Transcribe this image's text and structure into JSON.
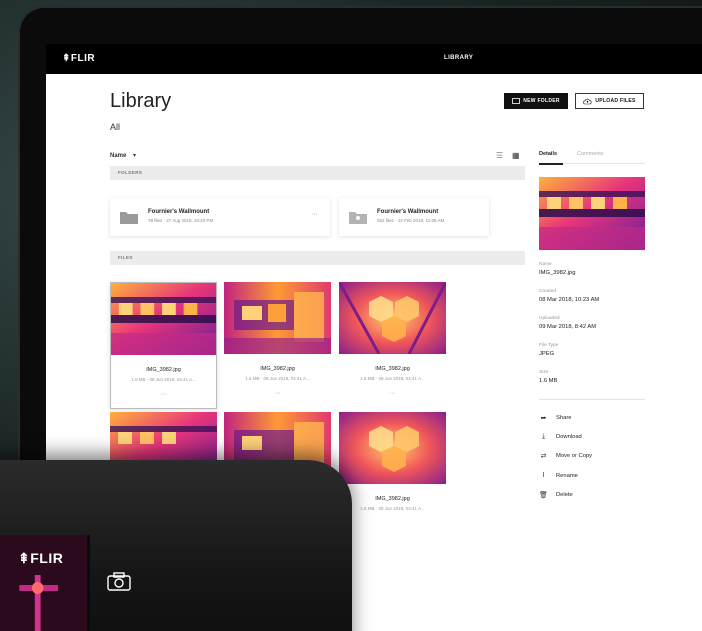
{
  "app": {
    "logo": "FLIR",
    "window_title": "LIBRARY"
  },
  "header": {
    "title": "Library",
    "subtitle": "All",
    "new_folder_label": "NEW FOLDER",
    "upload_files_label": "UPLOAD FILES"
  },
  "toolbar": {
    "sort_label": "Name",
    "sort_icon": "chevron-down-icon",
    "list_view_icon": "list-icon",
    "grid_view_icon": "grid-icon"
  },
  "sections": {
    "folders_label": "FOLDERS",
    "files_label": "FILES"
  },
  "folders": [
    {
      "name": "Fournier's Wallmount",
      "meta": "78 files · 27 Aug 2018, 10:23 PM"
    },
    {
      "name": "Fournier's Wallmount",
      "meta": "352 files · 12 Feb 2018, 11:08 AM"
    }
  ],
  "files": [
    {
      "name": "IMG_3982.jpg",
      "meta": "1.6 MB · 08 Jun 2018, 04:41 A...",
      "selected": true
    },
    {
      "name": "IMG_3982.jpg",
      "meta": "1.6 MB · 08 Jun 2018, 04:41 A...",
      "selected": false
    },
    {
      "name": "IMG_3982.jpg",
      "meta": "1.6 MB · 08 Jun 2018, 04:41 A...",
      "selected": false
    },
    {
      "name": "",
      "meta": "",
      "selected": false
    },
    {
      "name": "",
      "meta": "",
      "selected": false
    },
    {
      "name": "IMG_3982.jpg",
      "meta": "1.6 MB · 08 Jun 2018, 04:41 A...",
      "selected": false
    }
  ],
  "details": {
    "tab_details": "Details",
    "tab_comments": "Comments",
    "name_label": "Name",
    "name_value": "IMG_3982.jpg",
    "created_label": "Created",
    "created_value": "08 Mar 2018, 10:23 AM",
    "uploaded_label": "Uploaded",
    "uploaded_value": "09 Mar 2018, 8:42 AM",
    "filetype_label": "File Type",
    "filetype_value": "JPEG",
    "size_label": "Size",
    "size_value": "1.6 MB"
  },
  "actions": {
    "share": "Share",
    "download": "Download",
    "move": "Move or Copy",
    "rename": "Rename",
    "delete": "Delete"
  },
  "camera": {
    "logo": "FLIR"
  },
  "colors": {
    "thermal_hot": "#ffb13b",
    "thermal_mid": "#e8357a",
    "thermal_cold": "#4b1a8c",
    "topbar": "#000000",
    "primary_button": "#111111"
  }
}
